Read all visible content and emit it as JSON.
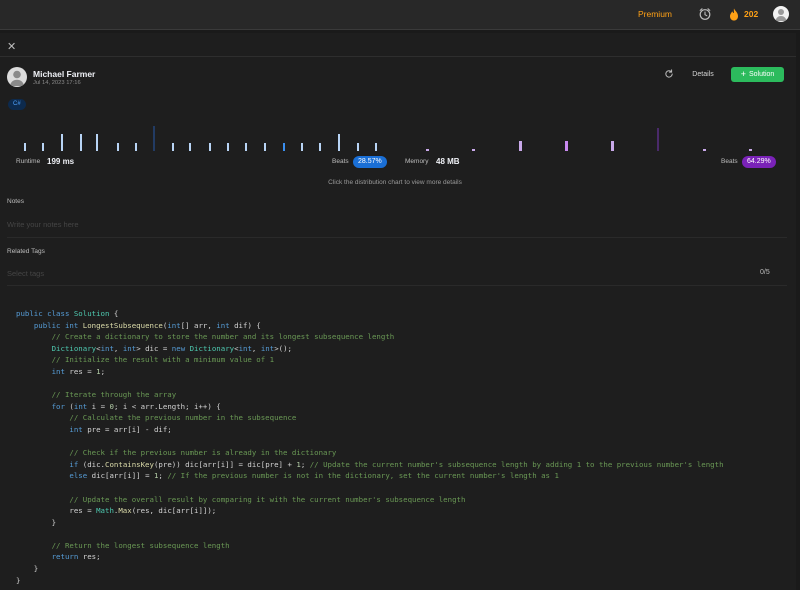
{
  "nav": {
    "premium": "Premium",
    "streak": "202",
    "colors": {
      "accent": "#ffa116"
    }
  },
  "header": {
    "author": "Michael Farmer",
    "date": "Jul 14, 2023 17:16",
    "details_label": "Details",
    "solution_label": "Solution",
    "language": "C#"
  },
  "stats": {
    "runtime_label": "Runtime",
    "runtime_value": "199 ms",
    "runtime_beats_label": "Beats",
    "runtime_beats": "28.57%",
    "memory_label": "Memory",
    "memory_value": "48 MB",
    "memory_beats_label": "Beats",
    "memory_beats": "64.29%",
    "hint": "Click the distribution chart to view more details",
    "colors": {
      "runtime": "#1a6fd6",
      "memory": "#7a22b8"
    }
  },
  "notes": {
    "label": "Notes",
    "placeholder": "Write your notes here"
  },
  "tags": {
    "label": "Related Tags",
    "placeholder": "Select tags",
    "count": "0/5"
  },
  "code": {
    "language": "C#",
    "lines": [
      [
        [
          "kw",
          "public"
        ],
        [
          "",
          "  "
        ],
        [
          "kw",
          "class"
        ],
        [
          "",
          ""
        ],
        [
          "ty",
          " Solution"
        ],
        [
          "",
          " {"
        ]
      ],
      [
        [
          "",
          "    "
        ],
        [
          "kw",
          "public"
        ],
        [
          "",
          " "
        ],
        [
          "kw",
          "int"
        ],
        [
          "",
          " "
        ],
        [
          "fn",
          "LongestSubsequence"
        ],
        [
          "",
          "("
        ],
        [
          "kw",
          "int"
        ],
        [
          "",
          "[] arr, "
        ],
        [
          "kw",
          "int"
        ],
        [
          "",
          " dif) {"
        ]
      ],
      [
        [
          "",
          "        "
        ],
        [
          "cm",
          "// Create a dictionary to store the number and its longest subsequence length"
        ]
      ],
      [
        [
          "",
          "        "
        ],
        [
          "ty",
          "Dictionary"
        ],
        [
          "",
          "<"
        ],
        [
          "kw",
          "int"
        ],
        [
          "",
          " , "
        ],
        [
          "kw",
          "int"
        ],
        [
          "",
          "> dic = "
        ],
        [
          "kw",
          "new"
        ],
        [
          "",
          " "
        ],
        [
          "ty",
          "Dictionary"
        ],
        [
          "",
          "<"
        ],
        [
          "kw",
          "int"
        ],
        [
          "",
          ", "
        ],
        [
          "kw",
          "int"
        ],
        [
          "",
          ">();"
        ]
      ],
      [
        [
          "",
          "        "
        ],
        [
          "cm",
          "// Initialize the result with a minimum value of 1"
        ]
      ],
      [
        [
          "",
          "        "
        ],
        [
          "kw",
          "int"
        ],
        [
          "",
          " res = "
        ],
        [
          "nu",
          "1"
        ],
        [
          "",
          ";"
        ]
      ],
      [
        [
          "",
          ""
        ]
      ],
      [
        [
          "",
          "        "
        ],
        [
          "cm",
          "// Iterate through the array"
        ]
      ],
      [
        [
          "",
          "        "
        ],
        [
          "kw",
          "for"
        ],
        [
          "",
          " ("
        ],
        [
          "kw",
          "int"
        ],
        [
          "",
          " i = "
        ],
        [
          "nu",
          "0"
        ],
        [
          "",
          "; i < arr.Length; i++) {"
        ]
      ],
      [
        [
          "",
          "            "
        ],
        [
          "cm",
          "// Calculate the previous number in the subsequence"
        ]
      ],
      [
        [
          "",
          "            "
        ],
        [
          "kw",
          "int"
        ],
        [
          "",
          " pre = arr[i] - dif;"
        ]
      ],
      [
        [
          "",
          ""
        ]
      ],
      [
        [
          "",
          "            "
        ],
        [
          "cm",
          "// Check if the previous number is already in the dictionary"
        ]
      ],
      [
        [
          "",
          "            "
        ],
        [
          "kw",
          "if"
        ],
        [
          "",
          " (dic."
        ],
        [
          "fn",
          "ContainsKey"
        ],
        [
          "",
          "(pre)) dic[arr[i]] = dic[pre] + "
        ],
        [
          "nu",
          "1"
        ],
        [
          "",
          "; "
        ],
        [
          "cm",
          "// Update the current number's subsequence length by adding 1 to the previous number's length"
        ]
      ],
      [
        [
          "",
          "            "
        ],
        [
          "kw",
          "else"
        ],
        [
          "",
          " dic[arr[i]] = "
        ],
        [
          "nu",
          "1"
        ],
        [
          "",
          "; "
        ],
        [
          "cm",
          "// If the previous number is not in the dictionary, set the current number's length as 1"
        ]
      ],
      [
        [
          "",
          ""
        ]
      ],
      [
        [
          "",
          "            "
        ],
        [
          "cm",
          "// Update the overall result by comparing it with the current number's subsequence length"
        ]
      ],
      [
        [
          "",
          "            res = "
        ],
        [
          "ty",
          "Math"
        ],
        [
          "",
          "."
        ],
        [
          "fn",
          "Max"
        ],
        [
          "",
          "(res, dic[arr[i]]);"
        ]
      ],
      [
        [
          "",
          "        }"
        ]
      ],
      [
        [
          "",
          ""
        ]
      ],
      [
        [
          "",
          "        "
        ],
        [
          "cm",
          "// Return the longest subsequence length"
        ]
      ],
      [
        [
          "",
          "        "
        ],
        [
          "kw",
          "return"
        ],
        [
          "",
          " res;"
        ]
      ],
      [
        [
          "",
          "    }"
        ]
      ],
      [
        [
          "",
          "}"
        ]
      ]
    ]
  }
}
